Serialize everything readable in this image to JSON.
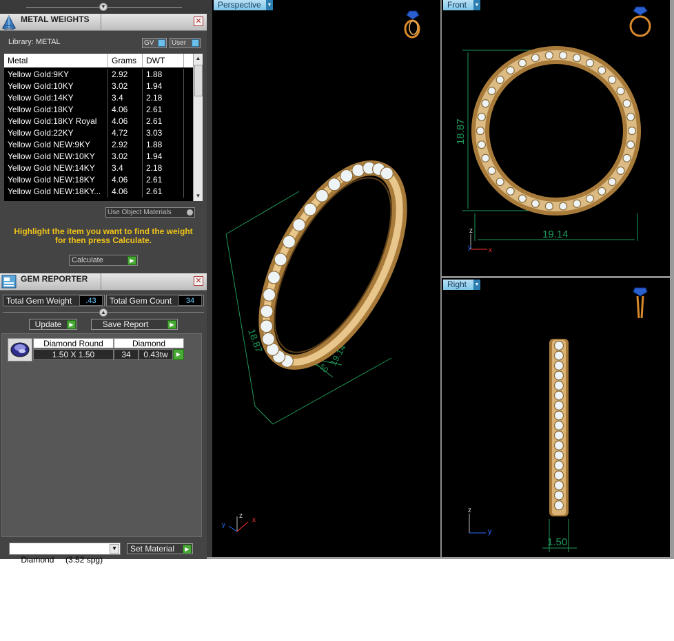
{
  "metal_weights": {
    "title": "METAL WEIGHTS",
    "library_label": "Library: METAL",
    "toggle_gv": "GV",
    "toggle_user": "User",
    "columns": [
      "Metal",
      "Grams",
      "DWT"
    ],
    "rows": [
      {
        "metal": "Yellow Gold:9KY",
        "grams": "2.92",
        "dwt": "1.88"
      },
      {
        "metal": "Yellow Gold:10KY",
        "grams": "3.02",
        "dwt": "1.94"
      },
      {
        "metal": "Yellow Gold:14KY",
        "grams": "3.4",
        "dwt": "2.18"
      },
      {
        "metal": "Yellow Gold:18KY",
        "grams": "4.06",
        "dwt": "2.61"
      },
      {
        "metal": "Yellow Gold:18KY Royal",
        "grams": "4.06",
        "dwt": "2.61"
      },
      {
        "metal": "Yellow Gold:22KY",
        "grams": "4.72",
        "dwt": "3.03"
      },
      {
        "metal": "Yellow Gold NEW:9KY",
        "grams": "2.92",
        "dwt": "1.88"
      },
      {
        "metal": "Yellow Gold NEW:10KY",
        "grams": "3.02",
        "dwt": "1.94"
      },
      {
        "metal": "Yellow Gold NEW:14KY",
        "grams": "3.4",
        "dwt": "2.18"
      },
      {
        "metal": "Yellow Gold NEW:18KY",
        "grams": "4.06",
        "dwt": "2.61"
      },
      {
        "metal": "Yellow Gold NEW:18KY...",
        "grams": "4.06",
        "dwt": "2.61"
      }
    ],
    "use_object_materials": "Use Object Materials",
    "hint": "Highlight the item you want to find the weight for then press Calculate.",
    "calculate_label": "Calculate"
  },
  "gem_reporter": {
    "title": "GEM REPORTER",
    "total_weight_label": "Total Gem Weight",
    "total_weight_value": ".43",
    "total_count_label": "Total Gem Count",
    "total_count_value": "34",
    "update_label": "Update",
    "save_report_label": "Save Report",
    "gem": {
      "shape": "Diamond Round",
      "type": "Diamond",
      "size": "1.50 X 1.50",
      "count": "34",
      "weight": "0.43tw"
    },
    "material_select": "Diamond     (3.52 spg)",
    "set_material_label": "Set Material"
  },
  "viewports": {
    "perspective": {
      "label": "Perspective",
      "dim_height": "18.87",
      "dim_width": "19.14",
      "dim_depth": "1.50",
      "axis_z": "z",
      "axis_y": "y",
      "axis_x": "x"
    },
    "front": {
      "label": "Front",
      "dim_height": "18.87",
      "dim_width": "19.14",
      "axis_z": "z",
      "axis_y": "y",
      "axis_x": "x"
    },
    "right": {
      "label": "Right",
      "dim_width": "1.50",
      "axis_z": "z",
      "axis_y": "y"
    }
  },
  "colors": {
    "gold": "#d9b377",
    "dimension_green": "#1f9a5a",
    "tab_blue": "#7ec6ea",
    "hint_yellow": "#f0c419",
    "go_green": "#48a935"
  },
  "icons": [
    "metal-weights-icon",
    "gem-reporter-icon",
    "close-icon",
    "collapse-arrow-icon",
    "go-arrow-icon",
    "dropdown-arrow-icon",
    "ring-view-icon",
    "gem-thumbnail-icon"
  ]
}
